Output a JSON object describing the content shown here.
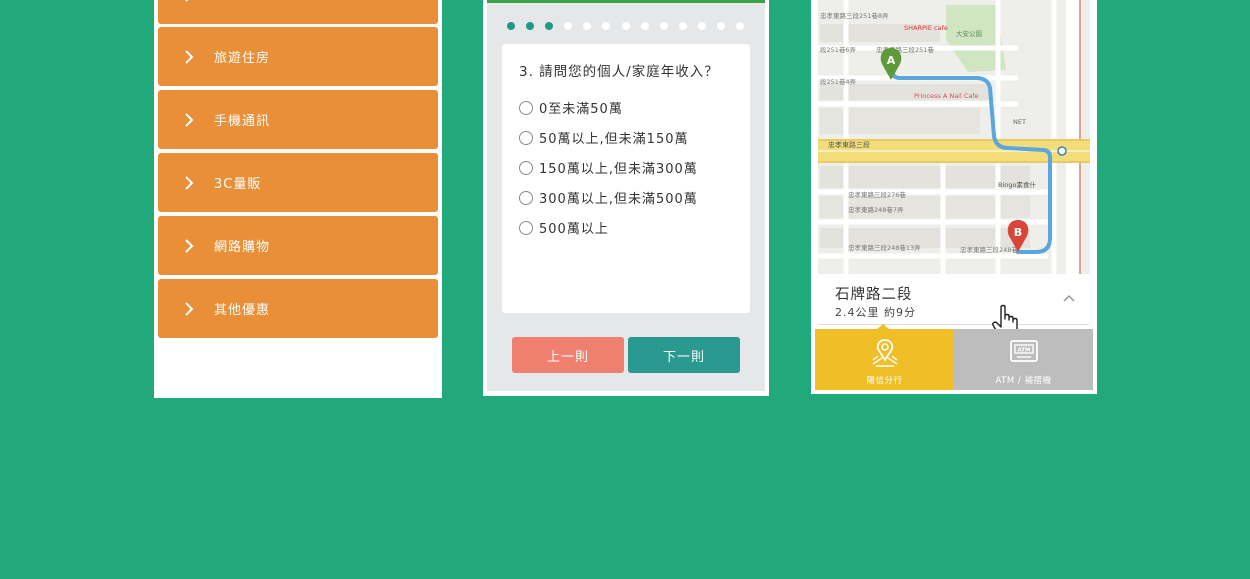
{
  "categories": [
    {
      "label": "旅遊住房"
    },
    {
      "label": "手機通訊"
    },
    {
      "label": "3C量販"
    },
    {
      "label": "網路購物"
    },
    {
      "label": "其他優惠"
    }
  ],
  "survey": {
    "total_steps": 13,
    "current_step": 3,
    "question": "3. 請問您的個人/家庭年收入？",
    "options": [
      "0至未滿50萬",
      "50萬以上,但未滿150萬",
      "150萬以上,但未滿300萬",
      "300萬以上,但未滿500萬",
      "500萬以上"
    ],
    "prev_label": "上一則",
    "next_label": "下一則"
  },
  "map": {
    "labels": {
      "road_main": "忠孝東路三段",
      "road_lane1": "忠孝東路三段251巷",
      "road_lane2": "忠孝東路三段248巷",
      "lane_276": "忠孝東路三段276巷",
      "lane_248_7": "忠孝東路248巷7弄",
      "lane_248_13": "忠孝東路三段248巷13弄",
      "lane_248_near_b": "忠孝東路三段248巷",
      "lane_251_8": "忠孝東路三段251巷8弄",
      "lane_251_6": "路251巷6弄",
      "lane_251_4": "段251巷4弄",
      "left_lane_6": "段251巷6弄",
      "lane_251_8_left": "忠孝東路三段251巷8弄",
      "shop_sharp": "SHARPIE cafe",
      "shop_princess": "Princess A Nail Cafe",
      "shop_bingo": "Bingo素食什",
      "shop_net": "NET",
      "park": "大安公園",
      "pin_a": "A",
      "pin_b": "B"
    },
    "route_color": "#5aa7e0"
  },
  "branch": {
    "name": "石牌路二段",
    "detail": "2.4公里  約9分"
  },
  "tabs": [
    {
      "label": "陽信分行",
      "icon": "map-pin-icon",
      "color": "#f0be27"
    },
    {
      "label": "ATM / 補摺機",
      "icon": "atm-icon",
      "color": "#bdbdbd"
    }
  ],
  "colors": {
    "background": "#21a97b",
    "category": "#e98f38",
    "dot_active": "#1e9a88",
    "prev_button": "#ef7f6e",
    "next_button": "#2a998f"
  }
}
